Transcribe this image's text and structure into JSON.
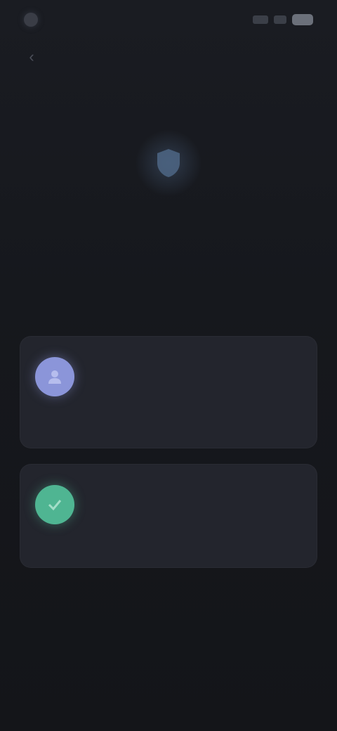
{
  "status_bar": {
    "time": "",
    "carrier": ""
  },
  "header": {
    "back_label": "‹"
  },
  "hero": {
    "icon": "shield-icon",
    "title": "",
    "subtitle": ""
  },
  "options": [
    {
      "icon": "person-icon",
      "color": "#8b95d9",
      "title": "",
      "description": ""
    },
    {
      "icon": "check-icon",
      "color": "#4fb592",
      "title": "",
      "description": ""
    }
  ],
  "footer": {
    "note": "",
    "link": ""
  },
  "colors": {
    "background": "#15171c",
    "card": "#23252d",
    "accent_purple": "#8b95d9",
    "accent_green": "#4fb592"
  }
}
